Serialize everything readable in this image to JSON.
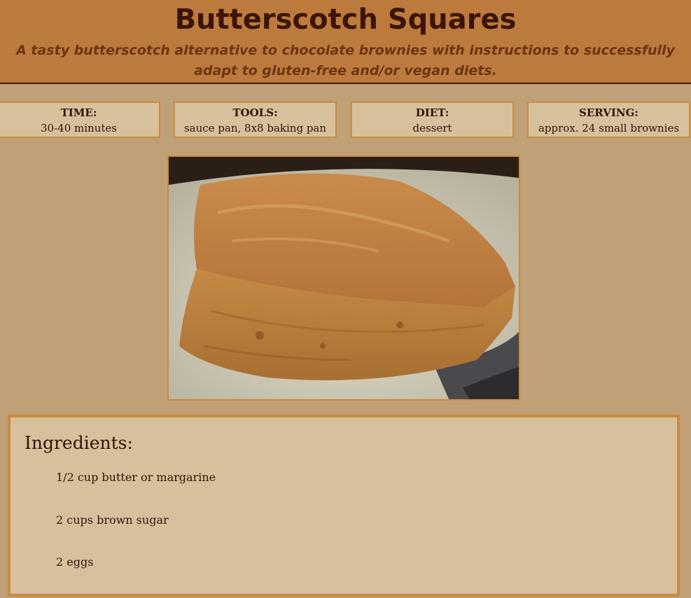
{
  "header": {
    "title": "Butterscotch Squares",
    "subtitle": "A tasty butterscotch alternative to chocolate brownies with instructions to successfully adapt to gluten-free and/or vegan diets."
  },
  "info": [
    {
      "label": "TIME:",
      "value": "30-40 minutes"
    },
    {
      "label": "TOOLS:",
      "value": "sauce pan, 8x8 baking pan"
    },
    {
      "label": "DIET:",
      "value": "dessert"
    },
    {
      "label": "SERVING:",
      "value": "approx. 24 small brownies"
    }
  ],
  "ingredients": {
    "title": "Ingredients:",
    "items": [
      "1/2 cup butter or margarine",
      "2 cups brown sugar",
      "2 eggs"
    ]
  },
  "colors": {
    "page_background": "#bfa077",
    "header_background": "#bd7a3d",
    "title": "#3a1407",
    "subtitle": "#6b3512",
    "box_background": "#d7c19c",
    "box_border": "#c98b3f"
  },
  "image": {
    "name": "butterscotch-square-photo"
  }
}
